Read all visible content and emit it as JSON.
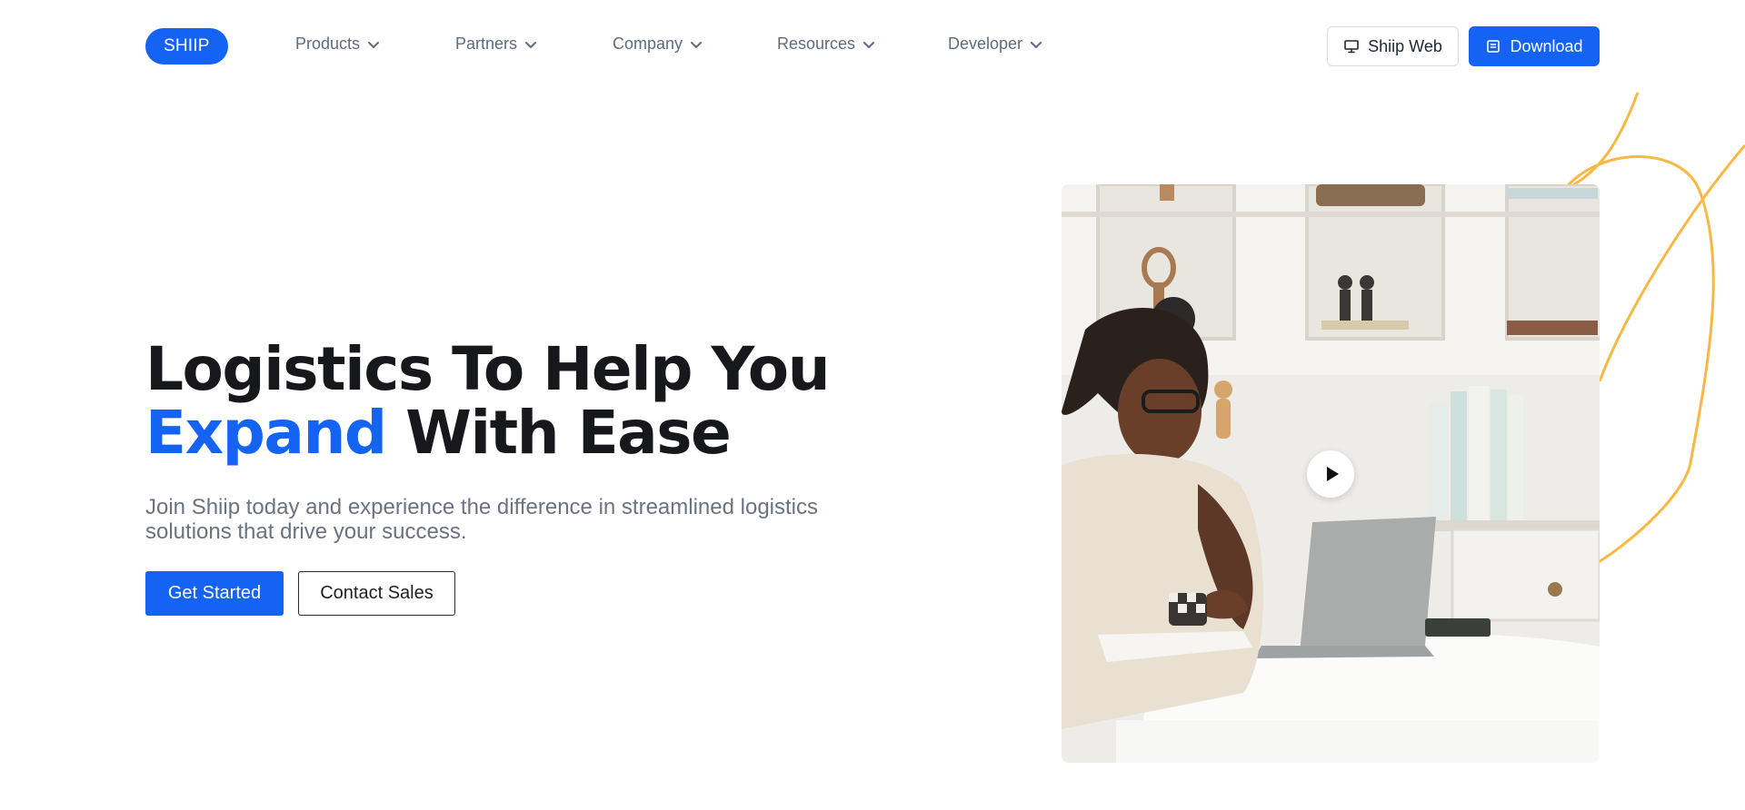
{
  "brand": {
    "logo_text": "SHIIP",
    "accent_color": "#1463f3",
    "decor_color": "#f7b844"
  },
  "nav": {
    "items": [
      {
        "label": "Products",
        "icon": "chevron-down-icon"
      },
      {
        "label": "Partners",
        "icon": "chevron-down-icon"
      },
      {
        "label": "Company",
        "icon": "chevron-down-icon"
      },
      {
        "label": "Resources",
        "icon": "chevron-down-icon"
      },
      {
        "label": "Developer",
        "icon": "chevron-down-icon"
      }
    ],
    "web_button": {
      "label": "Shiip Web",
      "icon": "monitor-icon"
    },
    "download_button": {
      "label": "Download",
      "icon": "download-icon"
    }
  },
  "hero": {
    "headline_line1": "Logistics To Help You",
    "headline_accent": "Expand",
    "headline_rest": "With Ease",
    "subtitle": "Join Shiip today and experience the difference in streamlined logistics solutions that drive your success.",
    "primary_cta": "Get Started",
    "secondary_cta": "Contact Sales"
  },
  "media": {
    "video_control": "play-icon"
  }
}
